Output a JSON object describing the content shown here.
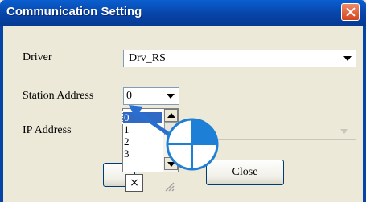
{
  "window": {
    "title": "Communication Setting"
  },
  "icons": {
    "close": "close-icon",
    "dropdown": "chevron-down-icon",
    "scroll_up": "scroll-up-icon",
    "scroll_down": "scroll-down-icon",
    "dismiss": "x-icon",
    "click_hint": "click-pointer-icon"
  },
  "form": {
    "driver": {
      "label": "Driver",
      "value": "Drv_RS"
    },
    "station_address": {
      "label": "Station Address",
      "value": "0",
      "options": [
        "0",
        "1",
        "2",
        "3"
      ],
      "selected": "0"
    },
    "ip_address": {
      "label": "IP Address"
    }
  },
  "buttons": {
    "close": "Close",
    "dismiss": "×"
  },
  "colors": {
    "titlebar": "#0744a8",
    "dialog_bg": "#ece9d8",
    "selection": "#316ac5",
    "hint_circle": "#1e7fd6",
    "hint_arrow": "#2a6fd0"
  }
}
